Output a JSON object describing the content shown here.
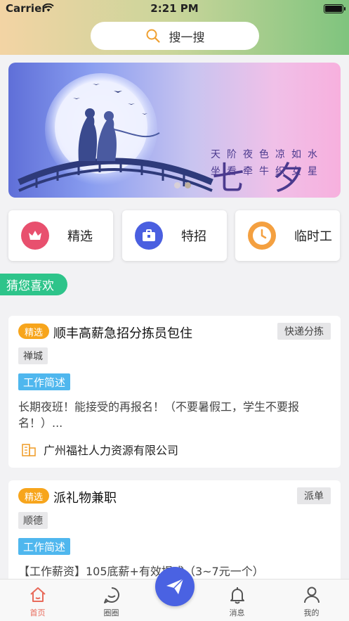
{
  "status_bar": {
    "carrier": "Carrier",
    "time": "2:21 PM"
  },
  "search": {
    "placeholder": "搜一搜",
    "icon": "search-icon"
  },
  "banner": {
    "title": "七夕",
    "poem_line1": "天阶夜色凉如水",
    "poem_line2": "坐看牵牛织女星",
    "slide_count": 2,
    "active_slide": 2
  },
  "categories": [
    {
      "label": "精选",
      "icon": "crown-icon",
      "color": "#e8506e"
    },
    {
      "label": "特招",
      "icon": "briefcase-icon",
      "color": "#4a5fe0"
    },
    {
      "label": "临时工",
      "icon": "clock-icon",
      "color": "#f4a040"
    }
  ],
  "section": {
    "title": "猜您喜欢"
  },
  "jobs": [
    {
      "badge": "精选",
      "title": "顺丰高薪急招分拣员包住",
      "type": "快递分拣",
      "location": "禅城",
      "desc_label": "工作简述",
      "desc": "长期夜班！能接受的再报名！（不要暑假工，学生不要报名！）...",
      "company": "广州福社人力资源有限公司"
    },
    {
      "badge": "精选",
      "title": "派礼物兼职",
      "type": "派单",
      "location": "顺德",
      "desc_label": "工作简述",
      "desc": "【工作薪资】105底薪+有效提成（3~7元一个）"
    }
  ],
  "tabbar": {
    "items": [
      {
        "label": "首页",
        "icon": "home-icon",
        "active": true
      },
      {
        "label": "圈圈",
        "icon": "chat-icon",
        "active": false
      },
      {
        "label": "消息",
        "icon": "bell-icon",
        "active": false
      },
      {
        "label": "我的",
        "icon": "person-icon",
        "active": false
      }
    ],
    "fab_icon": "paper-plane-icon"
  },
  "colors": {
    "accent_green": "#2ec48a",
    "badge_orange": "#f7a51c",
    "desc_blue": "#4fb7ee",
    "tab_active": "#e86a5a",
    "fab_blue": "#4a62e2"
  }
}
